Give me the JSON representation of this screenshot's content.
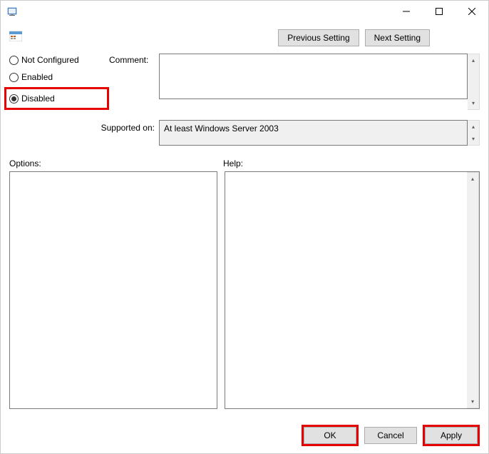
{
  "titlebar": {
    "title": ""
  },
  "nav": {
    "previous": "Previous Setting",
    "next": "Next Setting"
  },
  "radios": {
    "not_configured": "Not Configured",
    "enabled": "Enabled",
    "disabled": "Disabled",
    "selected": "disabled"
  },
  "labels": {
    "comment": "Comment:",
    "supported": "Supported on:",
    "options": "Options:",
    "help": "Help:"
  },
  "fields": {
    "comment": "",
    "supported": "At least Windows Server 2003",
    "options": "",
    "help": ""
  },
  "footer": {
    "ok": "OK",
    "cancel": "Cancel",
    "apply": "Apply"
  }
}
